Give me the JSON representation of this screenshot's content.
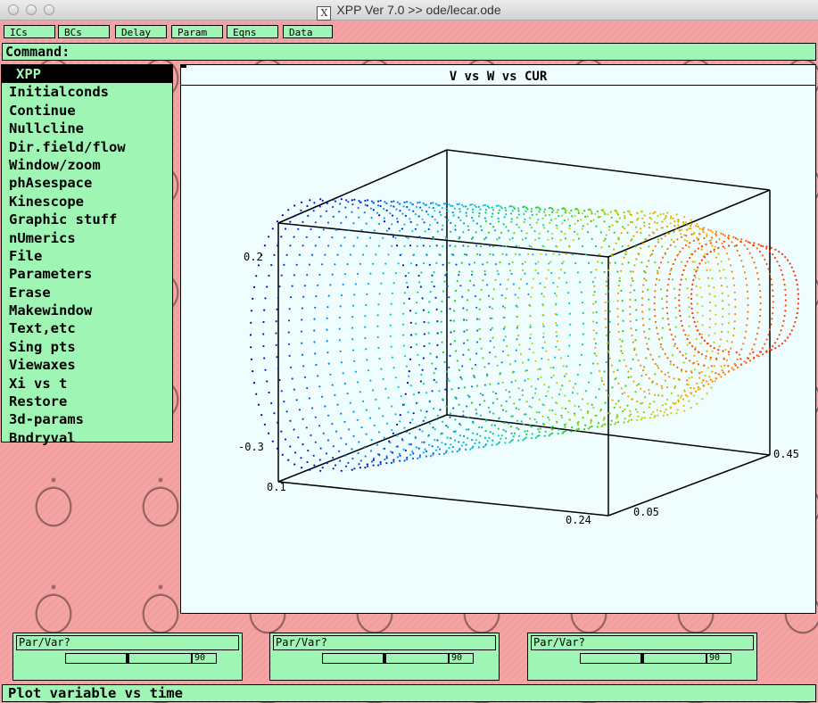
{
  "window": {
    "title": "XPP Ver 7.0 >> ode/lecar.ode",
    "x_icon": "X"
  },
  "toolbar": [
    {
      "label": "ICs"
    },
    {
      "label": "BCs"
    },
    {
      "label": "Delay"
    },
    {
      "label": "Param"
    },
    {
      "label": "Eqns"
    },
    {
      "label": "Data"
    }
  ],
  "command": {
    "label": "Command:"
  },
  "menu": {
    "items": [
      "XPP",
      "Initialconds",
      "Continue",
      "Nullcline",
      "Dir.field/flow",
      "Window/zoom",
      "phAsespace",
      "Kinescope",
      "Graphic stuff",
      "nUmerics",
      "File",
      "Parameters",
      "Erase",
      "Makewindow",
      "Text,etc",
      "Sing pts",
      "Viewaxes",
      "Xi vs t",
      "Restore",
      "3d-params",
      "Bndryval"
    ],
    "selected": "XPP"
  },
  "graph": {
    "title": "V vs W vs CUR"
  },
  "chart_data": {
    "type": "scatter",
    "title": "V vs W vs CUR",
    "projection": "3d",
    "axes": {
      "x_variable": "V",
      "y_variable": "W",
      "z_variable": "CUR",
      "tick_labels": [
        "0.2",
        "-0.3",
        "0.1",
        "0.24",
        "0.05",
        "0.45"
      ]
    },
    "series": [
      {
        "values": "family of closed orbits sweeping along the CUR axis, colored blue to red by CUR",
        "color_scale": [
          "#0000c8",
          "#0080ff",
          "#00d0d0",
          "#20d020",
          "#c8d800",
          "#ff9800",
          "#ff3000"
        ]
      }
    ],
    "grid": false
  },
  "sliders": [
    {
      "label": "Par/Var?",
      "value": "90",
      "level": 0.49
    },
    {
      "label": "Par/Var?",
      "value": "90",
      "level": 0.49
    },
    {
      "label": "Par/Var?",
      "value": "90",
      "level": 0.49
    }
  ],
  "status": {
    "text": "Plot variable vs time"
  },
  "colors": {
    "panel": "#9ff5b4",
    "wallpaper": "#f5a3a3",
    "plot_bg": "#f0fdff"
  }
}
